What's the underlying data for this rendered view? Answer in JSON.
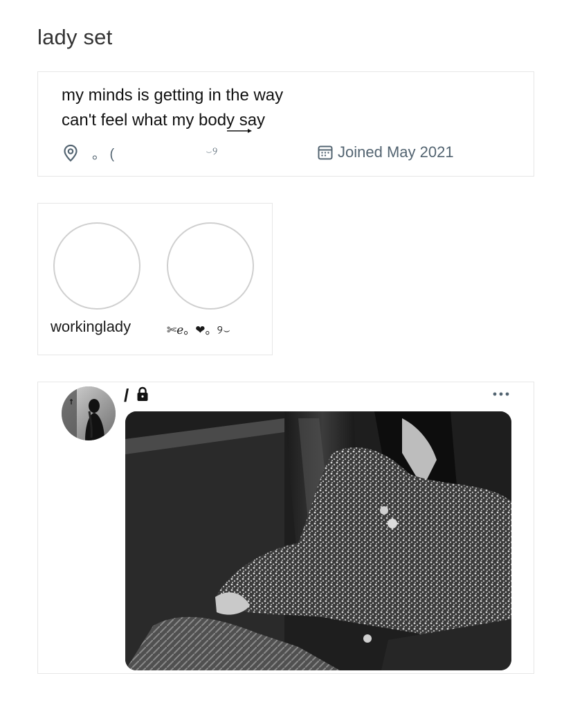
{
  "page": {
    "title": "lady set"
  },
  "bio": {
    "line1": "my minds is getting in the way",
    "line2": "can't feel what my body say",
    "location_text": "。 (",
    "location_decoration": "⌣୨",
    "joined": "Joined May 2021",
    "icons": {
      "location": "location-pin-icon",
      "calendar": "calendar-icon"
    }
  },
  "accounts": [
    {
      "name": "workinglady"
    },
    {
      "name": "✄ℯ。❤︎。୨⌣"
    }
  ],
  "tweet": {
    "handle": "/",
    "icons": {
      "lock": "lock-icon",
      "more": "more-options-icon"
    }
  },
  "colors": {
    "text_primary": "#111111",
    "text_secondary": "#536471",
    "border": "#e6e6e6",
    "avatar_ring": "#cfcfcf"
  }
}
